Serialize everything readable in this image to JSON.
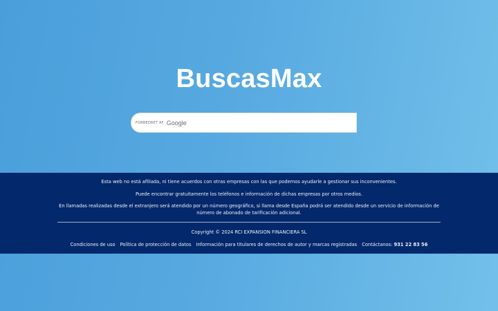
{
  "header": {
    "logo_text": "BuscasMax"
  },
  "search": {
    "powered_label": "FORBEDRET AF",
    "brand_label": "Google",
    "input_value": "",
    "placeholder": ""
  },
  "footer": {
    "notices": [
      "Esta web no está afiliada, ni tiene acuerdos con otras empresas con las que podemos ayudarle a gestionar sus inconvenientes.",
      "Puede encontrar gratuitamente los teléfonos e información de dichas empresas por otros medios.",
      "En llamadas realizadas desde el extranjero será atendido por un número geográfico, si llama desde España podrá ser atendido desde un servicio de información de número de abonado de tarificación adicional."
    ],
    "copyright": "Copyright © 2024 RCI EXPANSION FINANCIERA SL",
    "links": {
      "terms": "Condiciones de uso",
      "privacy": "Política de protección de datos",
      "rights": "Información para titulares de derechos de autor y marcas registradas",
      "contact_label": "Contáctanos:",
      "phone": "931 22 83 56"
    }
  },
  "colors": {
    "background_start": "#4a9fdb",
    "background_end": "#72c0ea",
    "footer_bg": "#03286b",
    "logo": "#ffffff"
  }
}
